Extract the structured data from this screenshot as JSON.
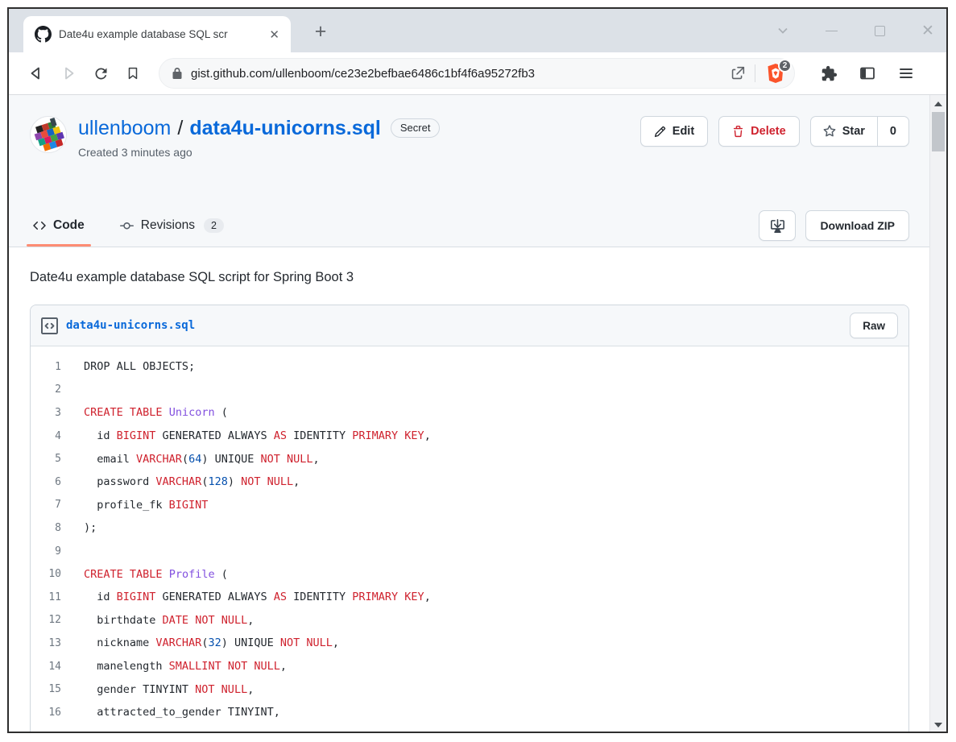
{
  "browser": {
    "tab_title": "Date4u example database SQL scr",
    "url": "gist.github.com/ullenboom/ce23e2befbae6486c1bf4f6a95272fb3",
    "shield_badge": "2"
  },
  "gist": {
    "owner": "ullenboom",
    "slash": "/",
    "title_file": "data4u-unicorns.sql",
    "visibility": "Secret",
    "created": "Created 3 minutes ago",
    "edit_label": "Edit",
    "delete_label": "Delete",
    "star_label": "Star",
    "star_count": "0",
    "tab_code": "Code",
    "tab_revisions": "Revisions",
    "revisions_count": "2",
    "download_zip": "Download ZIP",
    "description": "Date4u example database SQL script for Spring Boot 3",
    "file_name": "data4u-unicorns.sql",
    "raw_label": "Raw"
  },
  "code": {
    "lines": [
      {
        "num": "1",
        "tokens": [
          [
            "DROP ALL OBJECTS;",
            "p"
          ]
        ]
      },
      {
        "num": "2",
        "tokens": []
      },
      {
        "num": "3",
        "tokens": [
          [
            "CREATE TABLE",
            "k"
          ],
          [
            " ",
            "p"
          ],
          [
            "Unicorn",
            "e"
          ],
          [
            " (",
            "p"
          ]
        ]
      },
      {
        "num": "4",
        "tokens": [
          [
            "  id ",
            "p"
          ],
          [
            "BIGINT",
            "k"
          ],
          [
            " GENERATED ALWAYS ",
            "p"
          ],
          [
            "AS",
            "k"
          ],
          [
            " IDENTITY ",
            "p"
          ],
          [
            "PRIMARY KEY",
            "k"
          ],
          [
            ",",
            "p"
          ]
        ]
      },
      {
        "num": "5",
        "tokens": [
          [
            "  email ",
            "p"
          ],
          [
            "VARCHAR",
            "k"
          ],
          [
            "(",
            "p"
          ],
          [
            "64",
            "n"
          ],
          [
            ") UNIQUE ",
            "p"
          ],
          [
            "NOT NULL",
            "k"
          ],
          [
            ",",
            "p"
          ]
        ]
      },
      {
        "num": "6",
        "tokens": [
          [
            "  password ",
            "p"
          ],
          [
            "VARCHAR",
            "k"
          ],
          [
            "(",
            "p"
          ],
          [
            "128",
            "n"
          ],
          [
            ") ",
            "p"
          ],
          [
            "NOT NULL",
            "k"
          ],
          [
            ",",
            "p"
          ]
        ]
      },
      {
        "num": "7",
        "tokens": [
          [
            "  profile_fk ",
            "p"
          ],
          [
            "BIGINT",
            "k"
          ]
        ]
      },
      {
        "num": "8",
        "tokens": [
          [
            ");",
            "p"
          ]
        ]
      },
      {
        "num": "9",
        "tokens": []
      },
      {
        "num": "10",
        "tokens": [
          [
            "CREATE TABLE",
            "k"
          ],
          [
            " ",
            "p"
          ],
          [
            "Profile",
            "e"
          ],
          [
            " (",
            "p"
          ]
        ]
      },
      {
        "num": "11",
        "tokens": [
          [
            "  id ",
            "p"
          ],
          [
            "BIGINT",
            "k"
          ],
          [
            " GENERATED ALWAYS ",
            "p"
          ],
          [
            "AS",
            "k"
          ],
          [
            " IDENTITY ",
            "p"
          ],
          [
            "PRIMARY KEY",
            "k"
          ],
          [
            ",",
            "p"
          ]
        ]
      },
      {
        "num": "12",
        "tokens": [
          [
            "  birthdate ",
            "p"
          ],
          [
            "DATE",
            "k"
          ],
          [
            " ",
            "p"
          ],
          [
            "NOT NULL",
            "k"
          ],
          [
            ",",
            "p"
          ]
        ]
      },
      {
        "num": "13",
        "tokens": [
          [
            "  nickname ",
            "p"
          ],
          [
            "VARCHAR",
            "k"
          ],
          [
            "(",
            "p"
          ],
          [
            "32",
            "n"
          ],
          [
            ") UNIQUE ",
            "p"
          ],
          [
            "NOT NULL",
            "k"
          ],
          [
            ",",
            "p"
          ]
        ]
      },
      {
        "num": "14",
        "tokens": [
          [
            "  manelength ",
            "p"
          ],
          [
            "SMALLINT",
            "k"
          ],
          [
            " ",
            "p"
          ],
          [
            "NOT NULL",
            "k"
          ],
          [
            ",",
            "p"
          ]
        ]
      },
      {
        "num": "15",
        "tokens": [
          [
            "  gender TINYINT ",
            "p"
          ],
          [
            "NOT NULL",
            "k"
          ],
          [
            ",",
            "p"
          ]
        ]
      },
      {
        "num": "16",
        "tokens": [
          [
            "  attracted_to_gender TINYINT,",
            "p"
          ]
        ]
      }
    ]
  },
  "colors": {
    "accent_underline": "#fd8c73",
    "link_blue": "#0969da",
    "keyword_red": "#cf222e",
    "entity_purple": "#8250df",
    "number_blue": "#0550ae",
    "delete_red": "#cf222e",
    "brave_orange": "#fb542b"
  }
}
